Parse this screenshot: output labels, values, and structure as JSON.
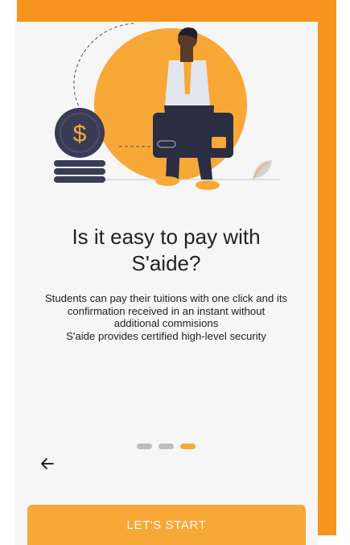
{
  "onboarding": {
    "headline_line1": "Is it easy to pay with",
    "headline_line2": "S'aide?",
    "body_lines": [
      "Students can pay their tuitions with one click and its",
      "confirmation received in an instant without",
      "additional commisions",
      "S'aide provides certified high-level security"
    ],
    "illustration_icon": "dollar-coin-icon",
    "pagination": {
      "total": 3,
      "active": 3
    },
    "back_icon": "arrow-left-icon",
    "start_label": "LET'S START"
  },
  "colors": {
    "accent": "#f7a837",
    "frame": "#f7941e",
    "coin": "#3a3b55",
    "screen_bg": "#f6f6f6",
    "dot_inactive": "#bdbdbd"
  }
}
